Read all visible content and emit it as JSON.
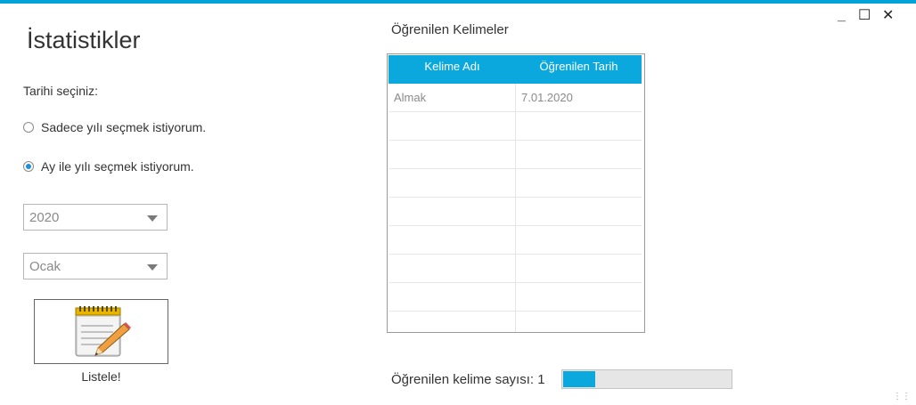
{
  "window": {
    "accent_color": "#00a2d8",
    "controls": {
      "minimize": "_",
      "maximize": "☐",
      "close": "✕"
    }
  },
  "left": {
    "title": "İstatistikler",
    "date_prompt": "Tarihi seçiniz:",
    "radio_year_only": {
      "label": "Sadece yılı seçmek istiyorum.",
      "selected": false
    },
    "radio_month_year": {
      "label": "Ay ile yılı seçmek istiyorum.",
      "selected": true
    },
    "year_combo": {
      "value": "2020"
    },
    "month_combo": {
      "value": "Ocak"
    },
    "list_button": {
      "icon": "notepad-pencil-icon",
      "label": "Listele!"
    }
  },
  "grid": {
    "title": "Öğrenilen Kelimeler",
    "header_color": "#0aa8dd",
    "columns": [
      "Kelime Adı",
      "Öğrenilen Tarih"
    ],
    "rows": [
      [
        "Almak",
        "7.01.2020"
      ],
      [
        "",
        ""
      ],
      [
        "",
        ""
      ],
      [
        "",
        ""
      ],
      [
        "",
        ""
      ],
      [
        "",
        ""
      ],
      [
        "",
        ""
      ],
      [
        "",
        ""
      ],
      [
        "",
        ""
      ]
    ]
  },
  "footer": {
    "count_label": "Öğrenilen kelime sayısı: 1",
    "progress_fraction": 0.19
  }
}
